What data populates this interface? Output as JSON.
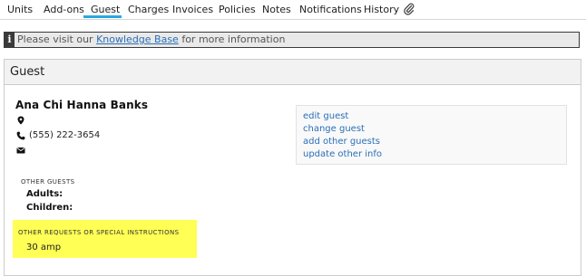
{
  "tabs": [
    {
      "label": "Units"
    },
    {
      "label": "Add-ons"
    },
    {
      "label": "Guest"
    },
    {
      "label": "Charges"
    },
    {
      "label": "Invoices"
    },
    {
      "label": "Policies"
    },
    {
      "label": "Notes"
    },
    {
      "label": "Notifications"
    },
    {
      "label": "History"
    }
  ],
  "active_tab": "Guest",
  "notice": {
    "before": "Please visit our ",
    "link": "Knowledge Base",
    "after": " for more information"
  },
  "panel": {
    "title": "Guest",
    "guest_name": "Ana Chi Hanna Banks",
    "phone": "(555) 222-3654",
    "actions": [
      {
        "label": "edit guest"
      },
      {
        "label": "change guest"
      },
      {
        "label": "add other guests"
      },
      {
        "label": "update other info"
      }
    ],
    "other_guests_label": "OTHER GUESTS",
    "adults_label": "Adults:",
    "children_label": "Children:",
    "requests_label": "OTHER REQUESTS OR SPECIAL INSTRUCTIONS",
    "requests_value": "30 amp"
  },
  "colors": {
    "accent": "#2aa7e0",
    "link": "#2a6fb8",
    "highlight": "#ffff55"
  },
  "icons": [
    "paperclip-icon",
    "info-icon",
    "map-marker-icon",
    "phone-icon",
    "envelope-icon"
  ]
}
